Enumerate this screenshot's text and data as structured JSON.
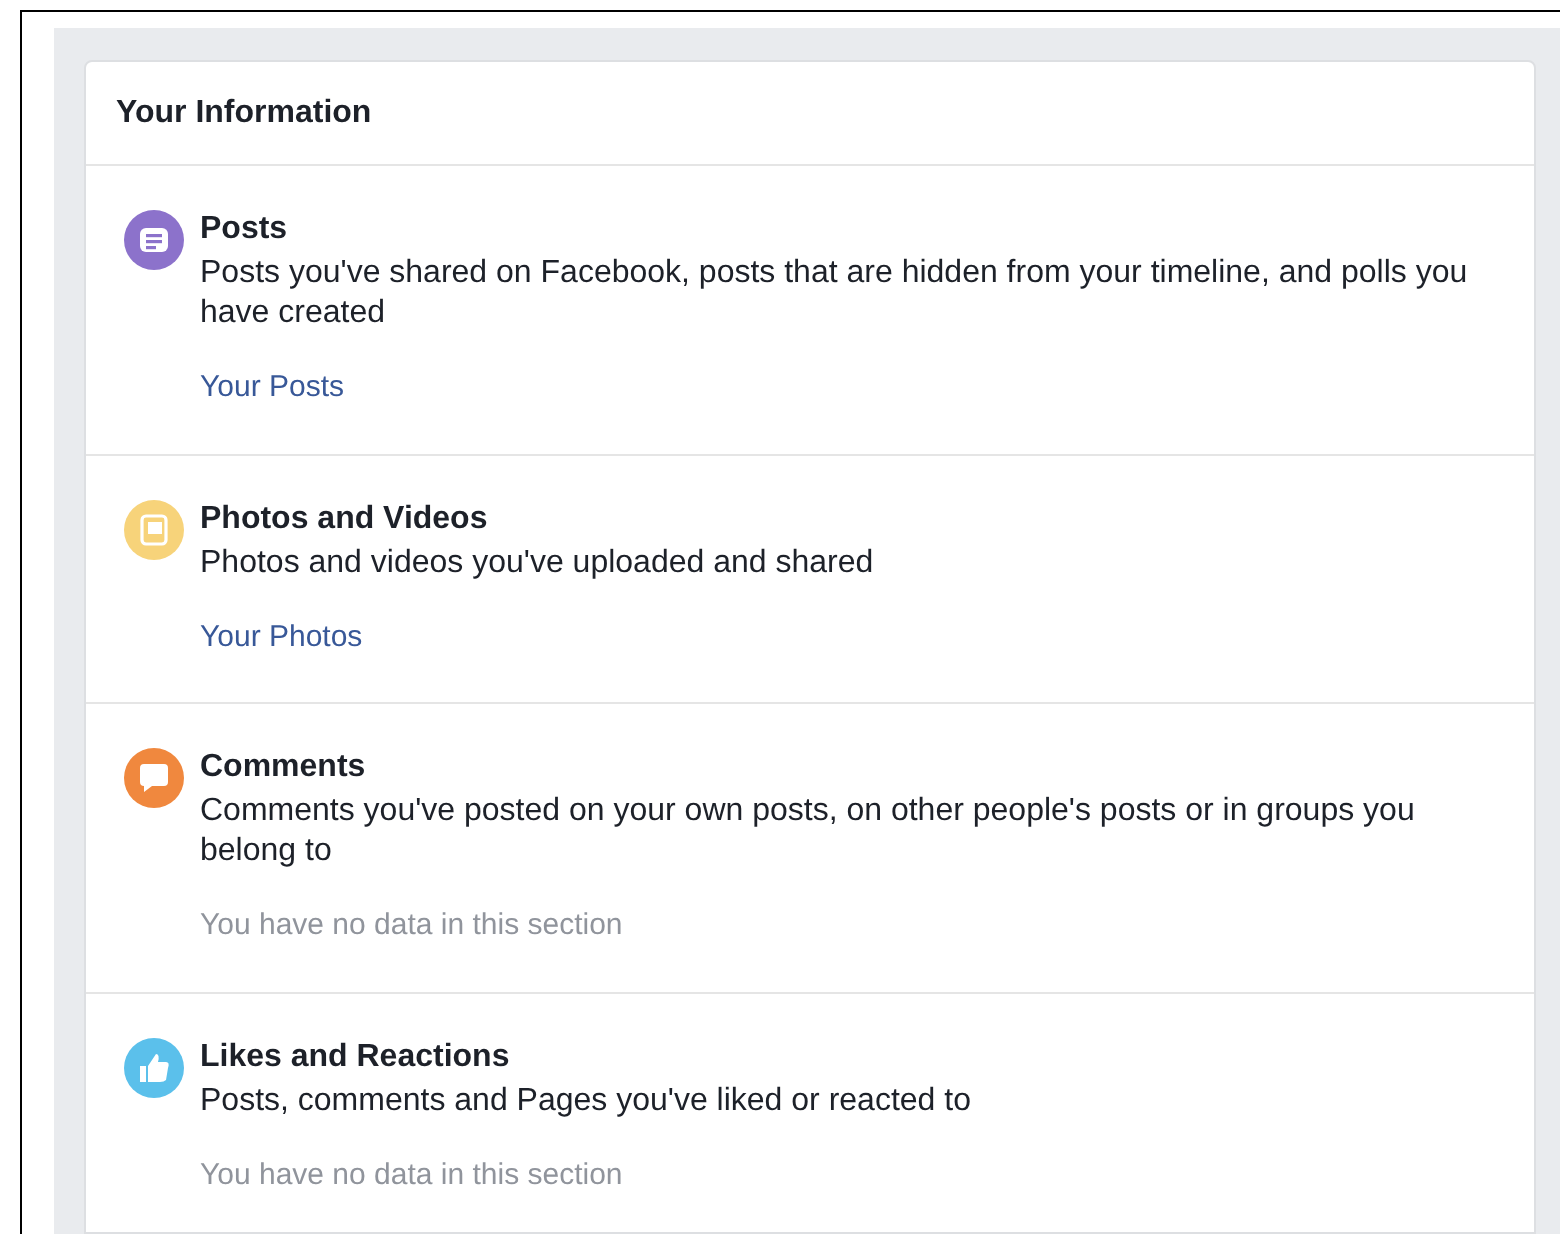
{
  "card": {
    "title": "Your Information"
  },
  "sections": [
    {
      "title": "Posts",
      "description": "Posts you've shared on Facebook, posts that are hidden from your timeline, and polls you have created",
      "footer": {
        "kind": "link",
        "text": "Your Posts"
      },
      "color": "#8c72cb"
    },
    {
      "title": "Photos and Videos",
      "description": "Photos and videos you've uploaded and shared",
      "footer": {
        "kind": "link",
        "text": "Your Photos"
      },
      "color": "#f7d37a"
    },
    {
      "title": "Comments",
      "description": "Comments you've posted on your own posts, on other people's posts or in groups you belong to",
      "footer": {
        "kind": "note",
        "text": "You have no data in this section"
      },
      "color": "#f0883e"
    },
    {
      "title": "Likes and Reactions",
      "description": "Posts, comments and Pages you've liked or reacted to",
      "footer": {
        "kind": "note",
        "text": "You have no data in this section"
      },
      "color": "#5bc0eb"
    }
  ]
}
